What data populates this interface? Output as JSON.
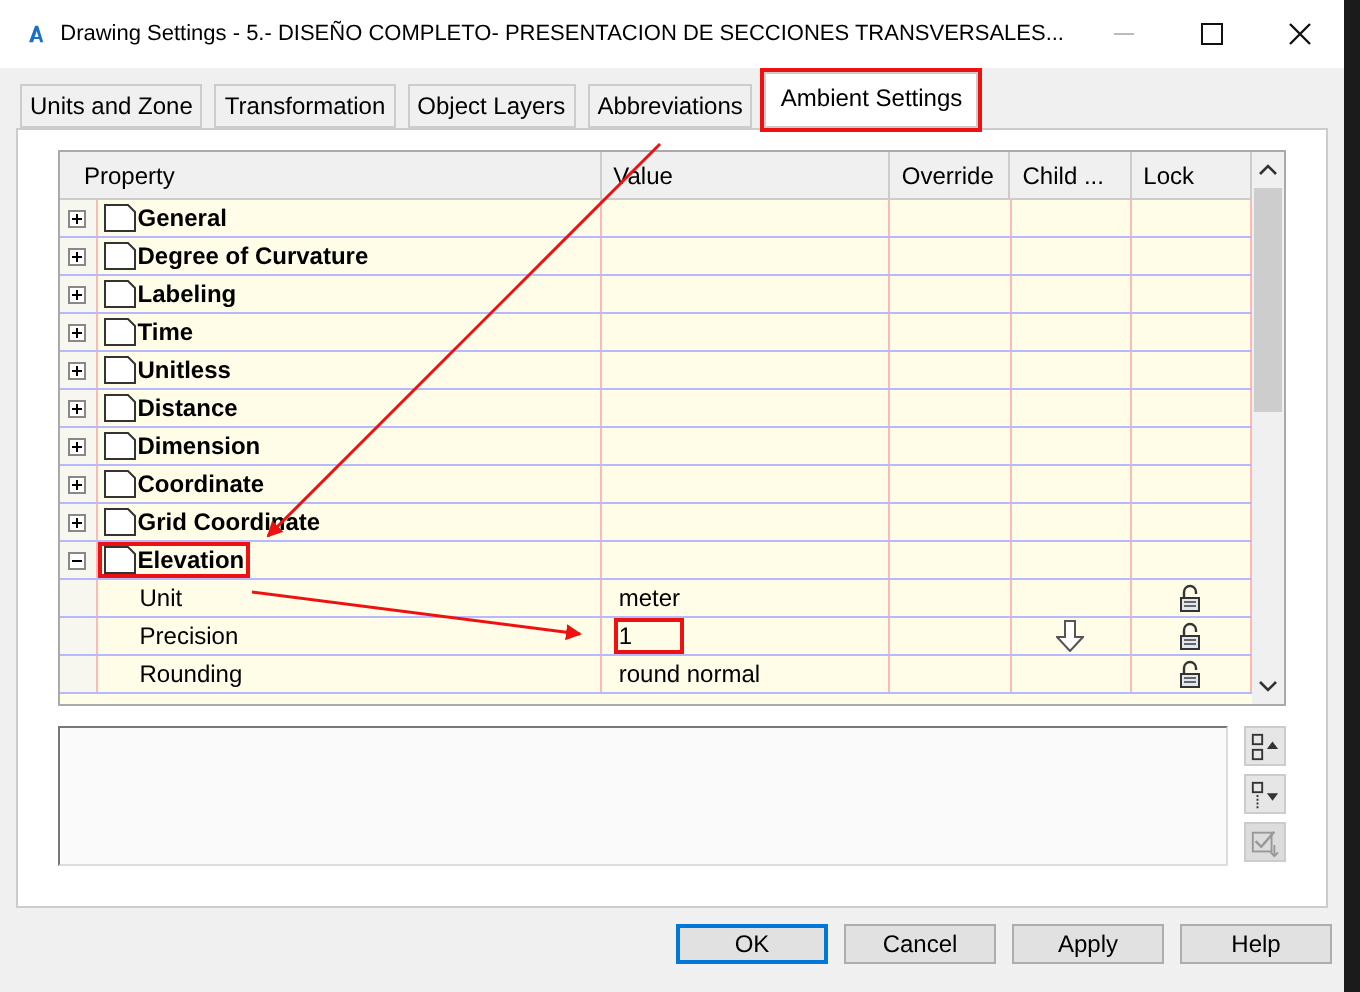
{
  "window": {
    "title": "Drawing Settings - 5.- DISEÑO COMPLETO- PRESENTACION DE  SECCIONES TRANSVERSALES..."
  },
  "tabs": [
    {
      "label": "Units and Zone",
      "selected": false,
      "highlighted": false
    },
    {
      "label": "Transformation",
      "selected": false,
      "highlighted": false
    },
    {
      "label": "Object Layers",
      "selected": false,
      "highlighted": false
    },
    {
      "label": "Abbreviations",
      "selected": false,
      "highlighted": false
    },
    {
      "label": "Ambient Settings",
      "selected": true,
      "highlighted": true
    }
  ],
  "grid": {
    "columns": [
      "Property",
      "Value",
      "Override",
      "Child ...",
      "Lock"
    ],
    "rows": [
      {
        "name": "General",
        "expanded": false,
        "highlighted": false
      },
      {
        "name": "Degree of Curvature",
        "expanded": false,
        "highlighted": false
      },
      {
        "name": "Labeling",
        "expanded": false,
        "highlighted": false
      },
      {
        "name": "Time",
        "expanded": false,
        "highlighted": false
      },
      {
        "name": "Unitless",
        "expanded": false,
        "highlighted": false
      },
      {
        "name": "Distance",
        "expanded": false,
        "highlighted": false
      },
      {
        "name": "Dimension",
        "expanded": false,
        "highlighted": false
      },
      {
        "name": "Coordinate",
        "expanded": false,
        "highlighted": false
      },
      {
        "name": "Grid Coordinate",
        "expanded": false,
        "highlighted": false
      },
      {
        "name": "Elevation",
        "expanded": true,
        "highlighted": true,
        "children": [
          {
            "name": "Unit",
            "value": "meter",
            "child_override": false,
            "locked": false,
            "highlighted": false
          },
          {
            "name": "Precision",
            "value": "1",
            "child_override": true,
            "locked": false,
            "highlighted": true
          },
          {
            "name": "Rounding",
            "value": "round normal",
            "child_override": false,
            "locked": false,
            "highlighted": false
          }
        ]
      }
    ]
  },
  "side_buttons": [
    {
      "kind": "collapse",
      "disabled": false
    },
    {
      "kind": "expand",
      "disabled": false
    },
    {
      "kind": "check",
      "disabled": true
    }
  ],
  "buttons": [
    {
      "label": "OK",
      "default": true
    },
    {
      "label": "Cancel",
      "default": false
    },
    {
      "label": "Apply",
      "default": false
    },
    {
      "label": "Help",
      "default": false
    }
  ]
}
